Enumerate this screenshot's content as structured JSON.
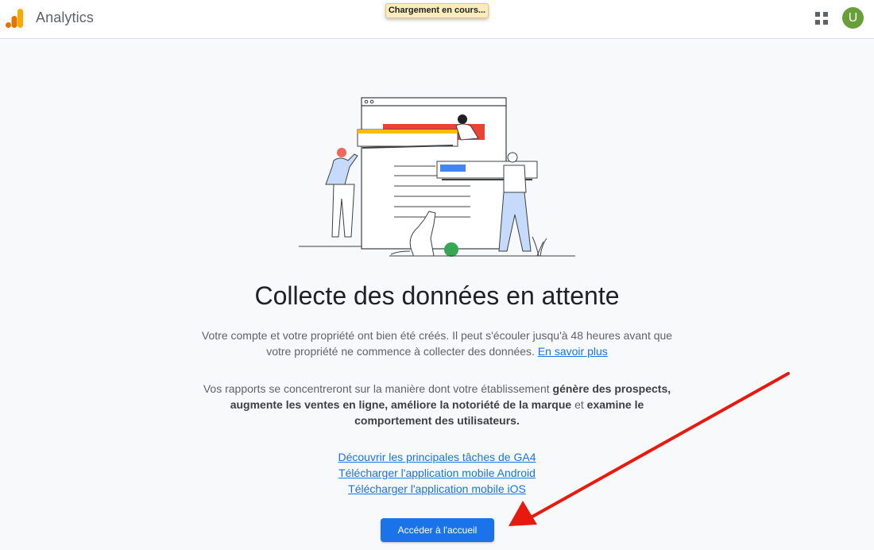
{
  "header": {
    "app_title": "Analytics",
    "loading_text": "Chargement en cours...",
    "avatar_initial": "U",
    "apps_icon": "grid-apps-icon",
    "logo_icon": "analytics-bars-icon"
  },
  "main": {
    "heading": "Collecte des données en attente",
    "paragraph1": {
      "text": "Votre compte et votre propriété ont bien été créés. Il peut s'écouler jusqu'à 48 heures avant que votre propriété ne commence à collecter des données.",
      "link": "En savoir plus"
    },
    "paragraph2": {
      "part1": "Vos rapports se concentreront sur la manière dont votre établissement",
      "bold1": "génère des prospects, augmente les ventes en ligne, améliore la notoriété de la marque",
      "part2": "et",
      "bold2": "examine le comportement des utilisateurs."
    },
    "links": [
      "Découvrir les principales tâches de GA4",
      "Télécharger l'application mobile Android",
      "Télécharger l'application mobile iOS"
    ],
    "home_button": "Accéder à l'accueil"
  },
  "colors": {
    "accent": "#1a73e8",
    "avatar": "#689f38",
    "annotation_arrow": "#e8190f",
    "logo_orange": "#f9ab00",
    "logo_dark_orange": "#e37400"
  }
}
